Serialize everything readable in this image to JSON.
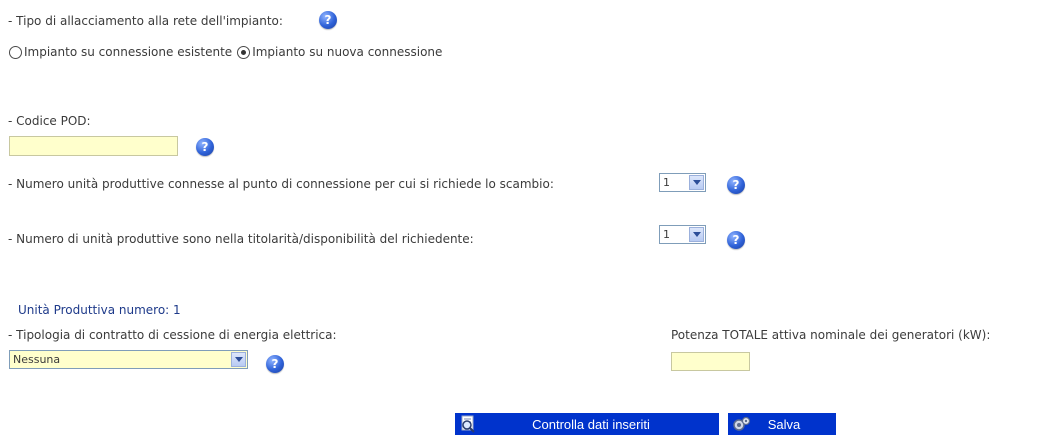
{
  "allacciamento": {
    "label": "- Tipo di allacciamento alla rete dell'impianto:",
    "options": [
      {
        "label": "Impianto su connessione esistente",
        "checked": false
      },
      {
        "label": "Impianto su nuova connessione",
        "checked": true
      }
    ]
  },
  "pod": {
    "label": "- Codice POD:",
    "value": ""
  },
  "unita_connesse": {
    "label": "- Numero unità produttive connesse al punto di connessione per cui si richiede lo scambio:",
    "selected": "1"
  },
  "unita_titolarita": {
    "label": "- Numero di unità produttive sono nella titolarità/disponibilità del richiedente:",
    "selected": "1"
  },
  "unita_produttiva": {
    "heading": "Unità Produttiva numero: 1",
    "contratto_label": "- Tipologia di contratto di cessione di energia elettrica:",
    "contratto_selected": "Nessuna",
    "potenza_label": "Potenza TOTALE attiva nominale dei generatori (kW):",
    "potenza_value": ""
  },
  "buttons": {
    "check_label": "Controlla dati inseriti",
    "save_label": "Salva"
  },
  "icons": {
    "help": "help-icon",
    "check": "magnifier-document-icon",
    "save": "save-gear-icon"
  },
  "help_glyph": "?",
  "colors": {
    "button_blue": "#0033cc",
    "input_yellow": "#ffffcc",
    "heading_blue": "#1e3a8a"
  }
}
